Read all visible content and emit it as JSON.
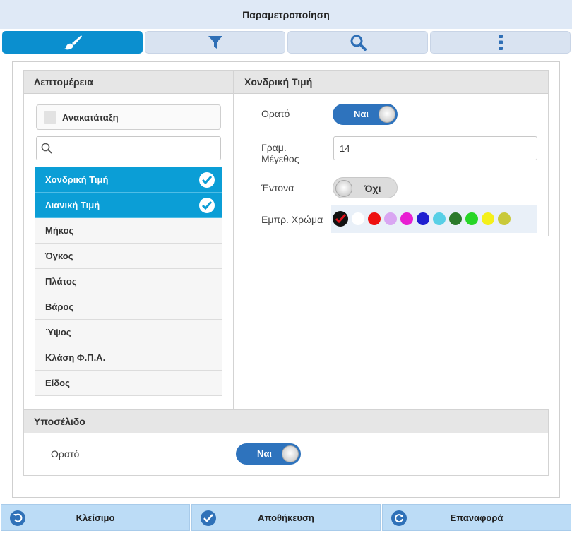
{
  "window": {
    "title": "Παραμετροποίηση"
  },
  "tabs": [
    {
      "icon": "paintbrush-icon",
      "active": true
    },
    {
      "icon": "filter-icon",
      "active": false
    },
    {
      "icon": "search-icon",
      "active": false
    },
    {
      "icon": "more-vertical-icon",
      "active": false
    }
  ],
  "details": {
    "header": "Λεπτομέρεια",
    "reorder_label": "Ανακατάταξη",
    "search_placeholder": "",
    "items": [
      {
        "label": "Χονδρική Τιμή",
        "selected": true
      },
      {
        "label": "Λιανική Τιμή",
        "selected": true
      },
      {
        "label": "Μήκος",
        "selected": false
      },
      {
        "label": "Όγκος",
        "selected": false
      },
      {
        "label": "Πλάτος",
        "selected": false
      },
      {
        "label": "Βάρος",
        "selected": false
      },
      {
        "label": "Ύψος",
        "selected": false
      },
      {
        "label": "Κλάση Φ.Π.Α.",
        "selected": false
      },
      {
        "label": "Είδος",
        "selected": false
      }
    ]
  },
  "field_settings": {
    "header": "Χονδρική Τιμή",
    "visible_label": "Ορατό",
    "visible_value": "Ναι",
    "font_size_label_line1": "Γραμ.",
    "font_size_label_line2": "Μέγεθος",
    "font_size_value": "14",
    "bold_label": "Έντονα",
    "bold_value": "Όχι",
    "color_label": "Εμπρ. Χρώμα",
    "colors": [
      "#111111",
      "#ffffff",
      "#ee1111",
      "#d9a6f2",
      "#e81fd2",
      "#1f1fd0",
      "#58cfe6",
      "#2b7a2b",
      "#27d627",
      "#f4f01a",
      "#c9c93a"
    ],
    "selected_color": "#111111"
  },
  "footer_section": {
    "header": "Υποσέλιδο",
    "visible_label": "Ορατό",
    "visible_value": "Ναι"
  },
  "bottom_bar": {
    "close_label": "Κλείσιμο",
    "save_label": "Αποθήκευση",
    "reset_label": "Επαναφορά"
  },
  "colors": {
    "accent": "#0b9ed6",
    "toggle_on": "#2e73bd",
    "bottom_button": "#bcdcf6"
  }
}
